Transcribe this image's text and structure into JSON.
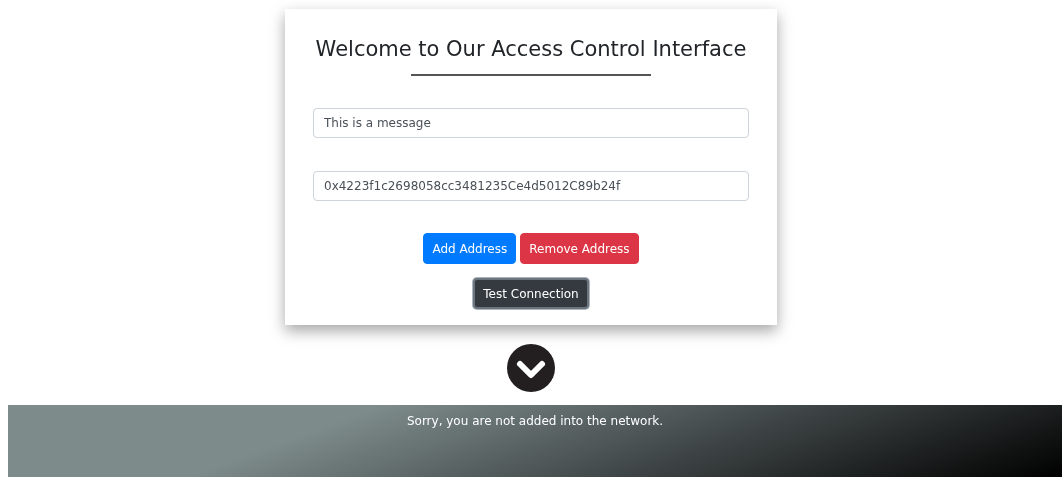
{
  "title": "Welcome to Our Access Control Interface",
  "fields": [
    {
      "value": "This is a message"
    },
    {
      "value": "0x4223f1c2698058cc3481235Ce4d5012C89b24f"
    }
  ],
  "button_rows": [
    [
      {
        "label": "Add Address",
        "kind": "primary"
      },
      {
        "label": "Remove Address",
        "kind": "danger"
      }
    ],
    [
      {
        "label": "Test Connection",
        "kind": "dark"
      }
    ]
  ],
  "banner": {
    "message": "Sorry, you are not added into the network."
  }
}
